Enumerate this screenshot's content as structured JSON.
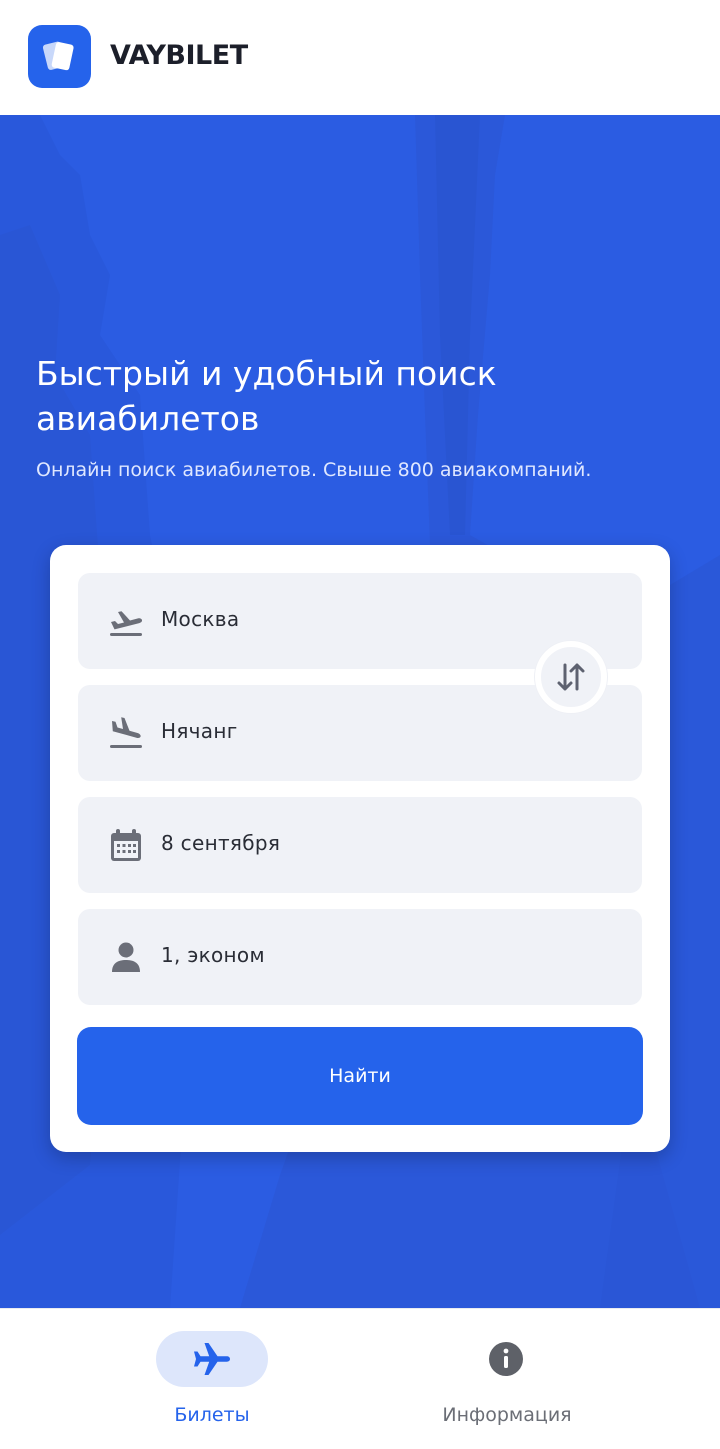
{
  "app": {
    "brand": "VAYBILET"
  },
  "hero": {
    "title": "Быстрый и удобный поиск авиабилетов",
    "subtitle": "Онлайн поиск авиабилетов. Свыше 800 авиакомпаний."
  },
  "search": {
    "from": {
      "value": "Москва",
      "icon": "plane-takeoff-icon"
    },
    "to": {
      "value": "Нячанг",
      "icon": "plane-landing-icon"
    },
    "date": {
      "value": "8 сентября",
      "icon": "calendar-icon"
    },
    "passengers": {
      "value": "1, эконом",
      "icon": "person-icon"
    },
    "swap_icon": "swap-arrows-icon",
    "submit_label": "Найти"
  },
  "bottom_nav": {
    "items": [
      {
        "label": "Билеты",
        "icon": "plane-icon",
        "active": true
      },
      {
        "label": "Информация",
        "icon": "info-icon",
        "active": false
      }
    ]
  },
  "colors": {
    "accent": "#2563EB",
    "hero_bg": "#2B5CE2",
    "field_bg": "#F0F2F7",
    "nav_active_pill": "#DDE6FB"
  }
}
